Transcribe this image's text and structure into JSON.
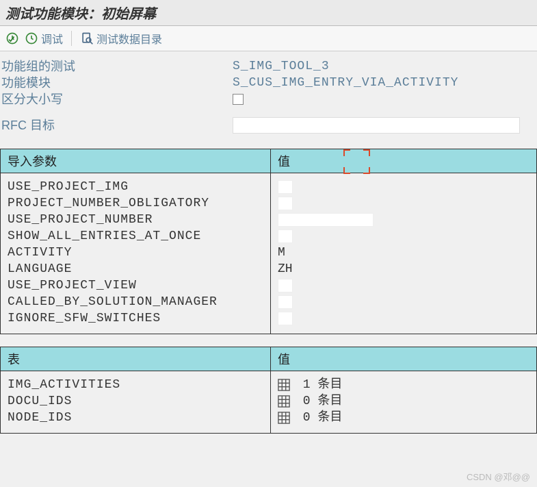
{
  "title": "测试功能模块：初始屏幕",
  "toolbar": {
    "debug_label": "调试",
    "data_dir_label": "测试数据目录"
  },
  "info": {
    "group_label": "功能组的测试",
    "group_value": "S_IMG_TOOL_3",
    "module_label": "功能模块",
    "module_value": "S_CUS_IMG_ENTRY_VIA_ACTIVITY",
    "case_label": "区分大小写",
    "rfc_label": "RFC 目标"
  },
  "import_section": {
    "header_param": "导入参数",
    "header_value": "值",
    "params": [
      {
        "name": "USE_PROJECT_IMG",
        "value": "",
        "field_width": "s"
      },
      {
        "name": "PROJECT_NUMBER_OBLIGATORY",
        "value": "",
        "field_width": "s"
      },
      {
        "name": "USE_PROJECT_NUMBER",
        "value": "",
        "field_width": "l"
      },
      {
        "name": "SHOW_ALL_ENTRIES_AT_ONCE",
        "value": "",
        "field_width": "s"
      },
      {
        "name": "ACTIVITY",
        "value": "M",
        "field_width": "none"
      },
      {
        "name": "LANGUAGE",
        "value": "ZH",
        "field_width": "none"
      },
      {
        "name": "USE_PROJECT_VIEW",
        "value": "",
        "field_width": "s"
      },
      {
        "name": "CALLED_BY_SOLUTION_MANAGER",
        "value": "",
        "field_width": "s"
      },
      {
        "name": "IGNORE_SFW_SWITCHES",
        "value": "",
        "field_width": "s"
      }
    ]
  },
  "tables_section": {
    "header_param": "表",
    "header_value": "值",
    "rows": [
      {
        "name": "IMG_ACTIVITIES",
        "count": "1",
        "suffix": "条目"
      },
      {
        "name": "DOCU_IDS",
        "count": "0",
        "suffix": "条目"
      },
      {
        "name": "NODE_IDS",
        "count": "0",
        "suffix": "条目"
      }
    ]
  },
  "watermark": "CSDN @邓@@"
}
